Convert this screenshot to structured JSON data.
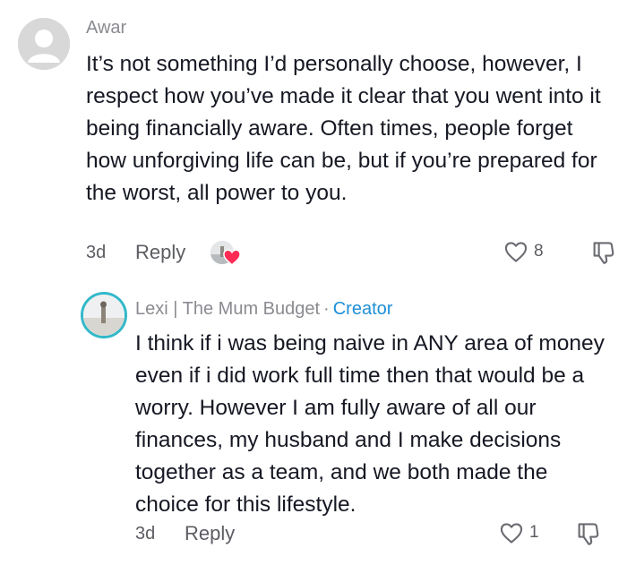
{
  "comments": [
    {
      "username": "Awar",
      "text": "It’s not something I’d personally choose, however, I respect how you’ve made it clear that you went into it being financially aware. Often times, people forget how unforgiving life can be, but if you’re prepared for the worst, all power to you.",
      "date": "3d",
      "reply_label": "Reply",
      "likes": "8",
      "creator_liked": true,
      "icons": {
        "avatar": "default-avatar-icon",
        "like": "heart-outline-icon",
        "dislike": "thumbs-down-icon",
        "creator_like": "creator-heart-icon"
      }
    },
    {
      "username": "Lexi | The Mum Budget",
      "separator": "·",
      "badge": "Creator",
      "text": "I think if i was being naive in ANY area of money even if i did work full time then that would be a worry. However I am fully aware of all our finances, my husband and I make decisions together as a team, and we both made the choice for this lifestyle.",
      "date": "3d",
      "reply_label": "Reply",
      "likes": "1",
      "icons": {
        "avatar": "profile-photo-avatar",
        "like": "heart-outline-icon",
        "dislike": "thumbs-down-icon"
      }
    }
  ],
  "colors": {
    "text": "#161823",
    "muted": "#8a8b91",
    "creator_badge": "#1f8fd6",
    "avatar_ring": "#31b9c9",
    "heart_red": "#fe2c55"
  }
}
